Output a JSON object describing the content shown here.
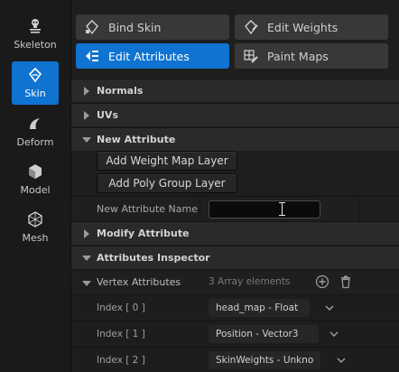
{
  "rail": {
    "items": [
      {
        "label": "Skeleton",
        "icon": "skeleton-icon",
        "active": false
      },
      {
        "label": "Skin",
        "icon": "skin-icon",
        "active": true
      },
      {
        "label": "Deform",
        "icon": "deform-icon",
        "active": false
      },
      {
        "label": "Model",
        "icon": "model-icon",
        "active": false
      },
      {
        "label": "Mesh",
        "icon": "mesh-icon",
        "active": false
      }
    ]
  },
  "modes": [
    {
      "label": "Bind Skin",
      "icon": "bind-skin-icon",
      "active": false
    },
    {
      "label": "Edit Weights",
      "icon": "edit-weights-icon",
      "active": false
    },
    {
      "label": "Edit Attributes",
      "icon": "edit-attributes-icon",
      "active": true
    },
    {
      "label": "Paint Maps",
      "icon": "paint-maps-icon",
      "active": false
    }
  ],
  "sections": {
    "normals": "Normals",
    "uvs": "UVs",
    "new_attribute": "New Attribute",
    "modify_attribute": "Modify Attribute",
    "attributes_inspector": "Attributes Inspector"
  },
  "new_attribute": {
    "add_weight_map_layer": "Add Weight Map Layer",
    "add_poly_group_layer": "Add Poly Group Layer",
    "name_label": "New Attribute Name",
    "name_value": ""
  },
  "inspector": {
    "vertex_attributes_label": "Vertex Attributes",
    "element_count": "3 Array elements",
    "entries": [
      {
        "index": "Index [ 0 ]",
        "value": "head_map - Float"
      },
      {
        "index": "Index [ 1 ]",
        "value": "Position  - Vector3"
      },
      {
        "index": "Index [ 2 ]",
        "value": "SkinWeights - Unkno"
      }
    ]
  },
  "colors": {
    "accent": "#0e73d1",
    "panel": "#1e1e1e",
    "section_header": "#2a2a2a"
  }
}
